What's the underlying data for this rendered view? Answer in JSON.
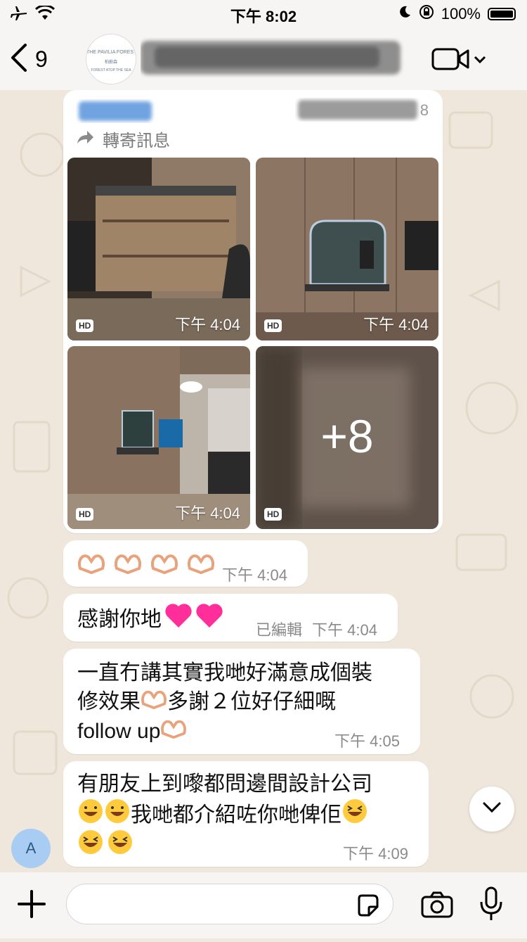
{
  "status_bar": {
    "time": "下午 8:02",
    "battery": "100%"
  },
  "header": {
    "back_count": "9",
    "logo": {
      "line1": "THE PAVILIA FOREST",
      "line2": "柏蔚森",
      "line3": "FOREST ATOP THE SEA"
    },
    "title_partial_digit": "8"
  },
  "messages": {
    "forward_label": "轉寄訊息",
    "photos": [
      {
        "badge": "HD",
        "time": "下午 4:04"
      },
      {
        "badge": "HD",
        "time": "下午 4:04"
      },
      {
        "badge": "HD",
        "time": "下午 4:04"
      },
      {
        "badge": "HD",
        "more": "+8"
      }
    ],
    "hearts": {
      "time": "下午 4:04"
    },
    "thanks": {
      "text": "感謝你地",
      "edited": "已編輯",
      "time": "下午 4:04"
    },
    "long1": {
      "line1": "一直冇講其實我哋好滿意成個裝",
      "line2a": "修效果",
      "line2b": " 多謝２位好仔細嘅",
      "line3": "follow up",
      "time": "下午 4:05"
    },
    "long2": {
      "line1": "有朋友上到嚟都問邊間設計公司",
      "line2": " 我哋都介紹咗你哋俾佢",
      "time": "下午 4:09"
    }
  },
  "sender_avatar": "A",
  "input": {
    "placeholder": ""
  },
  "colors": {
    "bubble": "#ffffff",
    "background": "#efe7dc",
    "avatar": "#a9cdf2",
    "heart": "#ff2e9a"
  }
}
